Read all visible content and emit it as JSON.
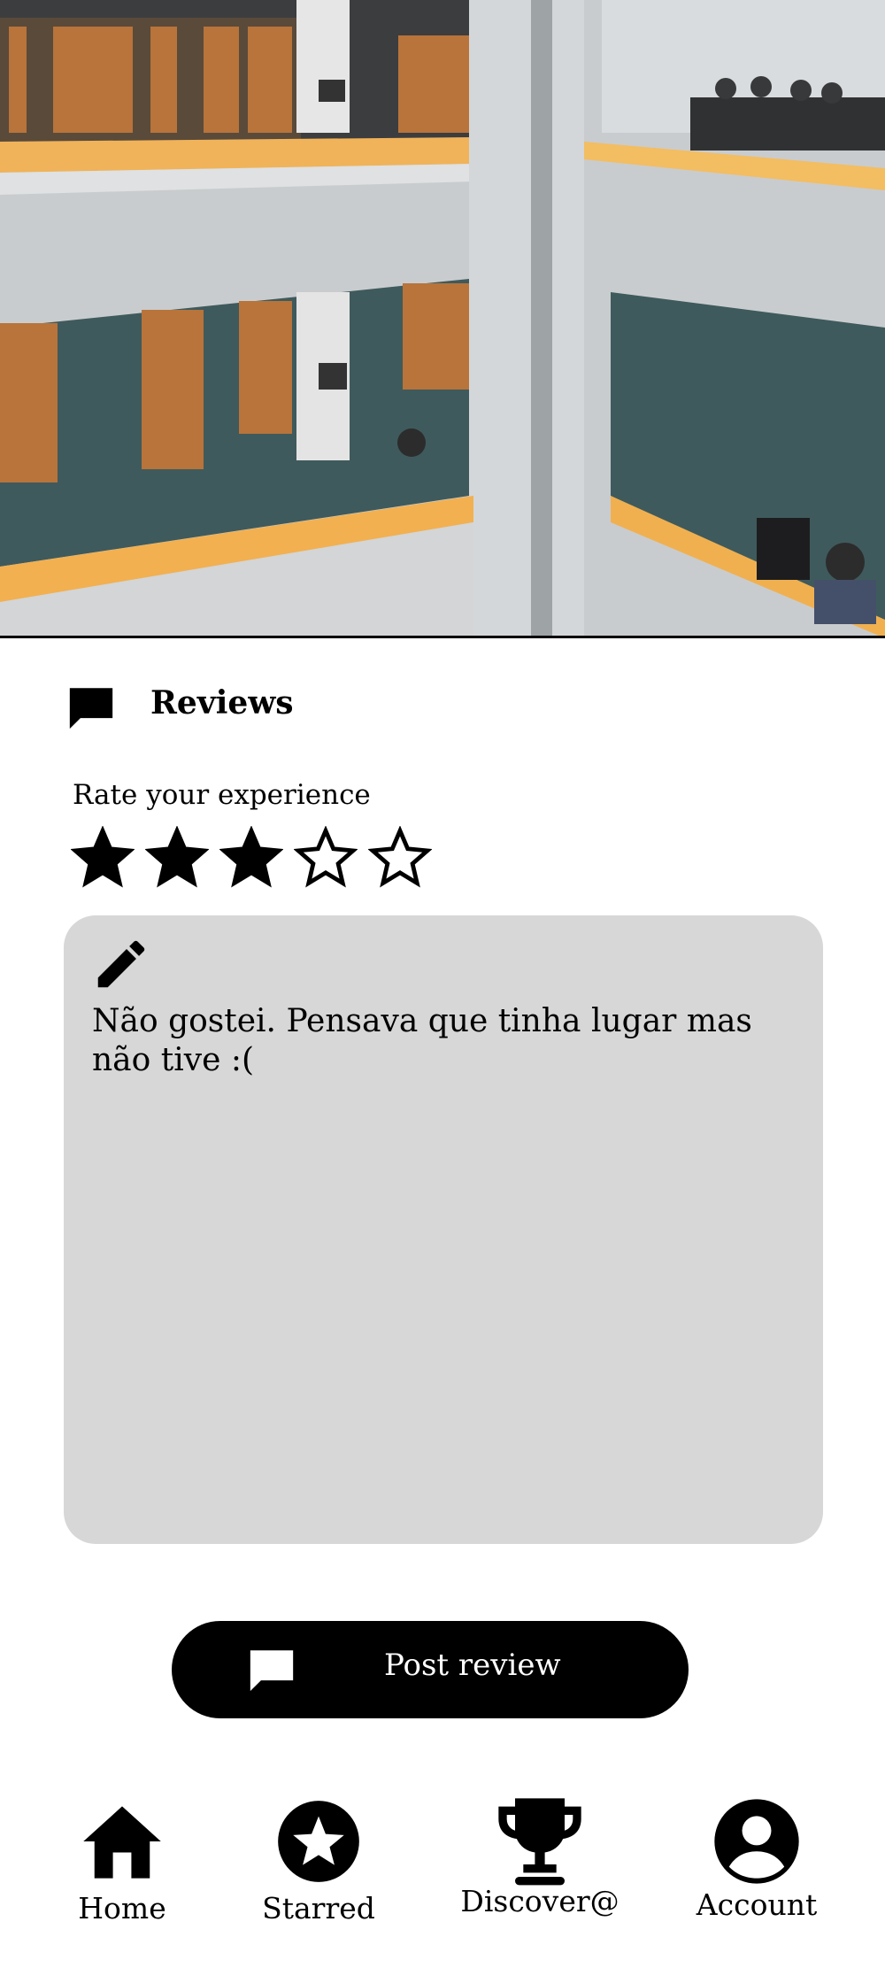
{
  "reviews": {
    "title": "Reviews",
    "icon": "chat-bubble-icon"
  },
  "rating": {
    "label": "Rate your experience",
    "value": 3,
    "max": 5
  },
  "review": {
    "text": "Não gostei. Pensava que tinha lugar mas não tive :(",
    "icon": "pencil-icon"
  },
  "post_button": {
    "label": "Post review",
    "icon": "chat-bubble-icon"
  },
  "nav": {
    "items": [
      {
        "label": "Home",
        "icon": "home-icon"
      },
      {
        "label": "Starred",
        "icon": "star-circle-icon"
      },
      {
        "label": "Discover@",
        "icon": "trophy-icon"
      },
      {
        "label": "Account",
        "icon": "account-circle-icon"
      }
    ]
  },
  "colors": {
    "accent": "#000000",
    "review_box": "#d7d7d7",
    "background": "#ffffff"
  }
}
